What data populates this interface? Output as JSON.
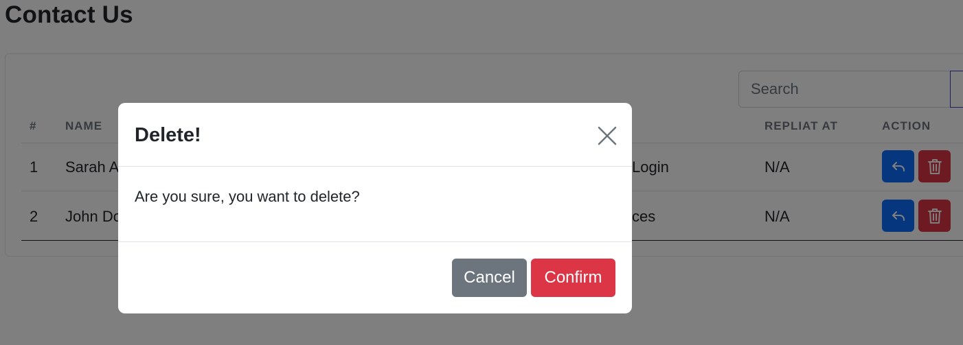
{
  "page": {
    "title": "Contact Us"
  },
  "search": {
    "placeholder": "Search",
    "value": ""
  },
  "table": {
    "columns": [
      "#",
      "NAME",
      "REPLIAT AT",
      "ACTION"
    ],
    "rows": [
      {
        "index": "1",
        "name": "Sarah A",
        "subject_fragment": "Login",
        "replied_at": "N/A"
      },
      {
        "index": "2",
        "name": "John Do",
        "subject_fragment": "ces",
        "replied_at": "N/A"
      }
    ]
  },
  "modal": {
    "title": "Delete!",
    "message": "Are you sure, you want to delete?",
    "cancel_label": "Cancel",
    "confirm_label": "Confirm"
  },
  "icons": {
    "close": "close-icon",
    "reply": "reply-icon",
    "trash": "trash-icon"
  },
  "colors": {
    "primary": "#0d6efd",
    "danger": "#dc3545",
    "secondary": "#6c757d",
    "overlay": "rgba(0,0,0,0.5)"
  }
}
